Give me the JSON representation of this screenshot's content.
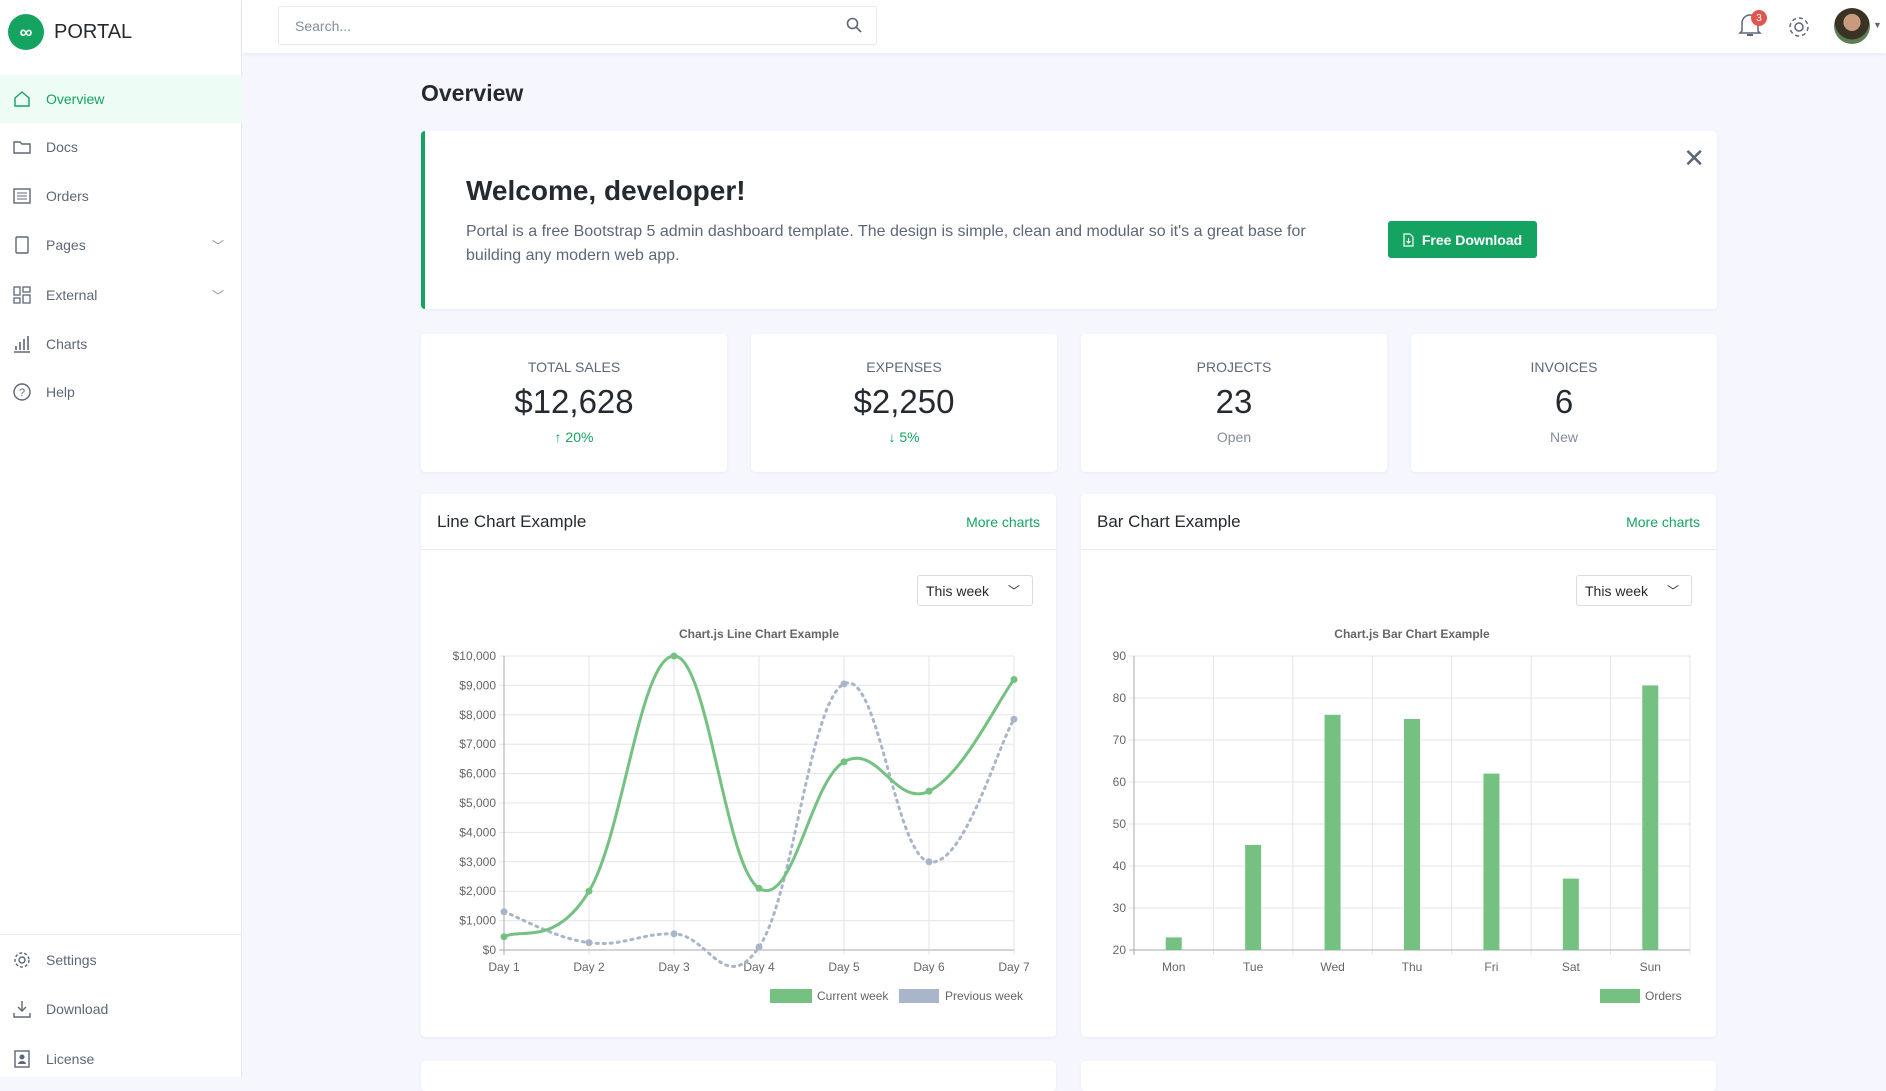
{
  "brand": {
    "name": "PORTAL",
    "logo_glyph": "∞"
  },
  "sidebar": {
    "items": [
      {
        "label": "Overview",
        "icon": "home-icon",
        "active": true
      },
      {
        "label": "Docs",
        "icon": "folder-icon"
      },
      {
        "label": "Orders",
        "icon": "list-icon"
      },
      {
        "label": "Pages",
        "icon": "pages-icon",
        "expandable": true
      },
      {
        "label": "External",
        "icon": "grid-icon",
        "expandable": true
      },
      {
        "label": "Charts",
        "icon": "bar-chart-icon"
      },
      {
        "label": "Help",
        "icon": "question-icon"
      }
    ],
    "bottom_items": [
      {
        "label": "Settings",
        "icon": "gear-icon"
      },
      {
        "label": "Download",
        "icon": "download-icon"
      },
      {
        "label": "License",
        "icon": "license-icon"
      }
    ]
  },
  "header": {
    "search_placeholder": "Search...",
    "notification_count": "3"
  },
  "page_title": "Overview",
  "welcome": {
    "title": "Welcome, developer!",
    "text": "Portal is a free Bootstrap 5 admin dashboard template. The design is simple, clean and modular so it's a great base for building any modern web app.",
    "button": "Free Download"
  },
  "stats": [
    {
      "label": "Total Sales",
      "value": "$12,628",
      "sub": "20%",
      "trend": "up"
    },
    {
      "label": "Expenses",
      "value": "$2,250",
      "sub": "5%",
      "trend": "down"
    },
    {
      "label": "Projects",
      "value": "23",
      "sub": "Open"
    },
    {
      "label": "Invoices",
      "value": "6",
      "sub": "New"
    }
  ],
  "colors": {
    "accent": "#15a362",
    "chart_green": "#75c181",
    "chart_gray": "#a9b5c9"
  },
  "line_card": {
    "title": "Line Chart Example",
    "link": "More charts",
    "select": "This week"
  },
  "bar_card": {
    "title": "Bar Chart Example",
    "link": "More charts",
    "select": "This week"
  },
  "chart_data": [
    {
      "type": "line",
      "title": "Chart.js Line Chart Example",
      "categories": [
        "Day 1",
        "Day 2",
        "Day 3",
        "Day 4",
        "Day 5",
        "Day 6",
        "Day 7"
      ],
      "ylim": [
        0,
        10000
      ],
      "yticks": [
        "$0",
        "$1,000",
        "$2,000",
        "$3,000",
        "$4,000",
        "$5,000",
        "$6,000",
        "$7,000",
        "$8,000",
        "$9,000",
        "$10,000"
      ],
      "grid": true,
      "legend": "bottom-right",
      "series": [
        {
          "name": "Current week",
          "values": [
            450,
            2000,
            10000,
            2100,
            6400,
            5400,
            9200
          ]
        },
        {
          "name": "Previous week",
          "values": [
            1300,
            250,
            550,
            100,
            9050,
            3000,
            7850
          ]
        }
      ]
    },
    {
      "type": "bar",
      "title": "Chart.js Bar Chart Example",
      "categories": [
        "Mon",
        "Tue",
        "Wed",
        "Thu",
        "Fri",
        "Sat",
        "Sun"
      ],
      "ylim": [
        20,
        90
      ],
      "yticks": [
        "20",
        "30",
        "40",
        "50",
        "60",
        "70",
        "80",
        "90"
      ],
      "grid": true,
      "legend": "bottom-right",
      "series": [
        {
          "name": "Orders",
          "values": [
            23,
            45,
            76,
            75,
            62,
            37,
            83
          ]
        }
      ]
    }
  ]
}
